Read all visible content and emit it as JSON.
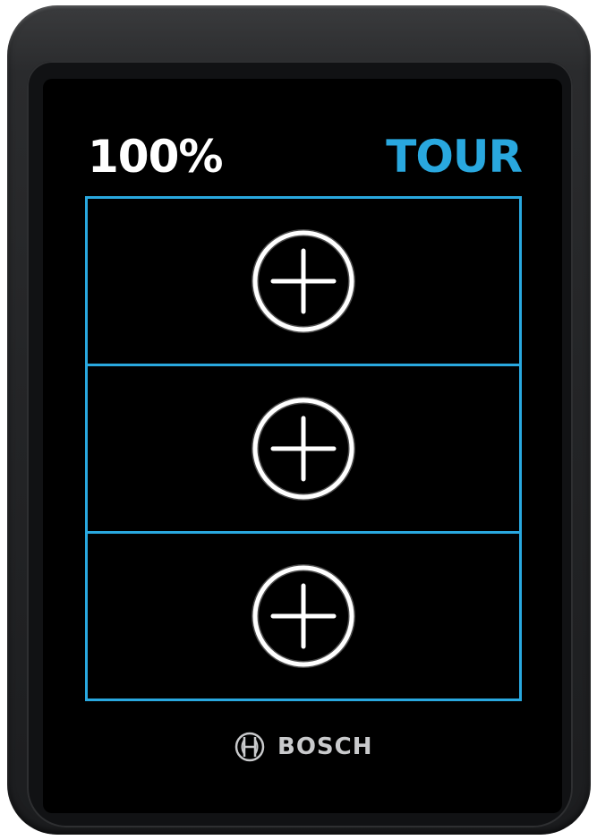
{
  "status": {
    "battery": "100%",
    "mode": "TOUR"
  },
  "tiles": [
    {
      "icon": "add-circle-icon"
    },
    {
      "icon": "add-circle-icon"
    },
    {
      "icon": "add-circle-icon"
    }
  ],
  "brand": {
    "name": "BOSCH",
    "logo_icon": "bosch-armature-icon"
  },
  "colors": {
    "accent": "#29a8df",
    "text": "#ffffff",
    "background": "#000000",
    "brand_text": "#c9cacc"
  }
}
